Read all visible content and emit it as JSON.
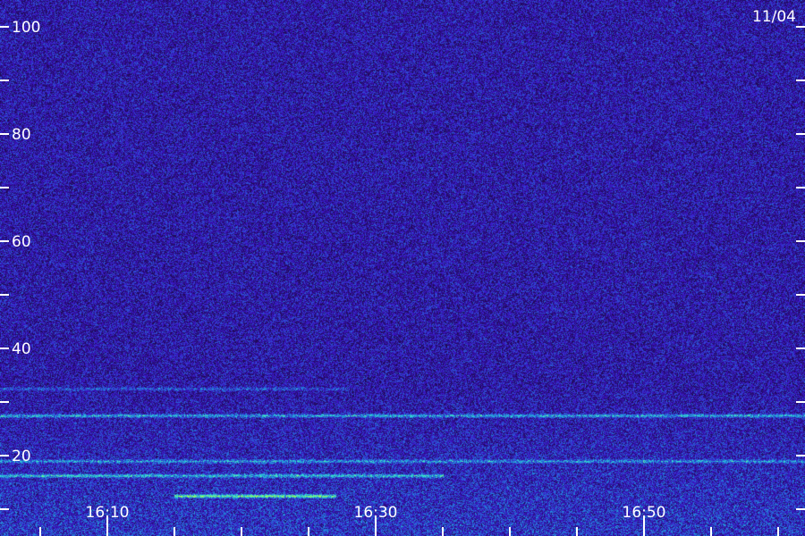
{
  "chart_data": {
    "type": "heatmap",
    "title": "",
    "date_label": "11/04",
    "xlabel": "",
    "ylabel": "",
    "y_ticks": [
      "100",
      "80",
      "60",
      "40",
      "20"
    ],
    "y_tick_values": [
      100,
      80,
      60,
      40,
      20
    ],
    "y_minor_tick_values": [
      90,
      70,
      50,
      30,
      10
    ],
    "ylim": [
      5,
      105
    ],
    "x_ticks": [
      "16:10",
      "16:30",
      "16:50"
    ],
    "x_tick_values_min": [
      970,
      990,
      1010
    ],
    "x_minor_tick_values_min": [
      965,
      975,
      980,
      985,
      995,
      1000,
      1005,
      1015,
      1020
    ],
    "xlim_min": [
      962,
      1022
    ],
    "colors": {
      "background": "#1c0a4a",
      "low": "#3c14c8",
      "mid": "#1e8cdc",
      "high": "#38e6d2",
      "peak": "#b4ff3c",
      "text": "#ffffff"
    },
    "bands": [
      {
        "y_value": 27.5,
        "intensity": 0.55,
        "x_range_min": [
          962,
          1022
        ]
      },
      {
        "y_value": 19.0,
        "intensity": 0.45,
        "x_range_min": [
          962,
          1022
        ]
      },
      {
        "y_value": 16.3,
        "intensity": 0.6,
        "x_range_min": [
          962,
          995
        ]
      },
      {
        "y_value": 12.5,
        "intensity": 0.85,
        "x_range_min": [
          975,
          987
        ]
      },
      {
        "y_value": 32.5,
        "intensity": 0.3,
        "x_range_min": [
          962,
          988
        ]
      }
    ]
  }
}
